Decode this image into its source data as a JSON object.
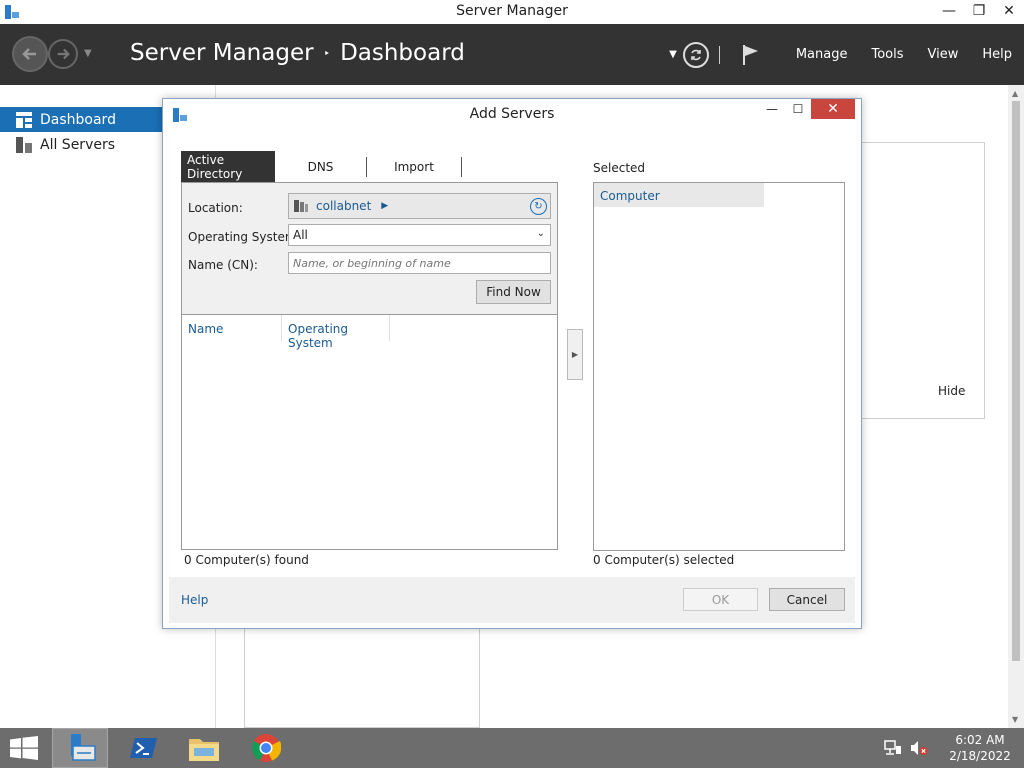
{
  "window": {
    "title": "Server Manager",
    "controls": {
      "minimize": "—",
      "restore": "❐",
      "close": "✕"
    }
  },
  "header": {
    "breadcrumb_root": "Server Manager",
    "breadcrumb_sep": "‣",
    "breadcrumb_page": "Dashboard",
    "menu": [
      "Manage",
      "Tools",
      "View",
      "Help"
    ]
  },
  "sidebar": {
    "items": [
      {
        "label": "Dashboard",
        "icon": "dashboard-icon",
        "active": true
      },
      {
        "label": "All Servers",
        "icon": "servers-icon",
        "active": false
      }
    ]
  },
  "background": {
    "hide_label": "Hide"
  },
  "dialog": {
    "title": "Add Servers",
    "tabs": [
      "Active Directory",
      "DNS",
      "Import"
    ],
    "location_label": "Location:",
    "location_value": "collabnet",
    "os_label": "Operating System:",
    "os_value": "All",
    "name_label": "Name (CN):",
    "name_placeholder": "Name, or beginning of name",
    "find_button": "Find Now",
    "columns": [
      "Name",
      "Operating System"
    ],
    "found_text": "0 Computer(s) found",
    "selected_label": "Selected",
    "selected_column": "Computer",
    "selected_text": "0 Computer(s) selected",
    "help_link": "Help",
    "ok_button": "OK",
    "cancel_button": "Cancel"
  },
  "taskbar": {
    "time": "6:02 AM",
    "date": "2/18/2022"
  },
  "colors": {
    "header_bg": "#333333",
    "accent": "#1a6fb5",
    "link": "#1a5b93",
    "close_red": "#c8463d",
    "taskbar": "#6d6d6d"
  }
}
